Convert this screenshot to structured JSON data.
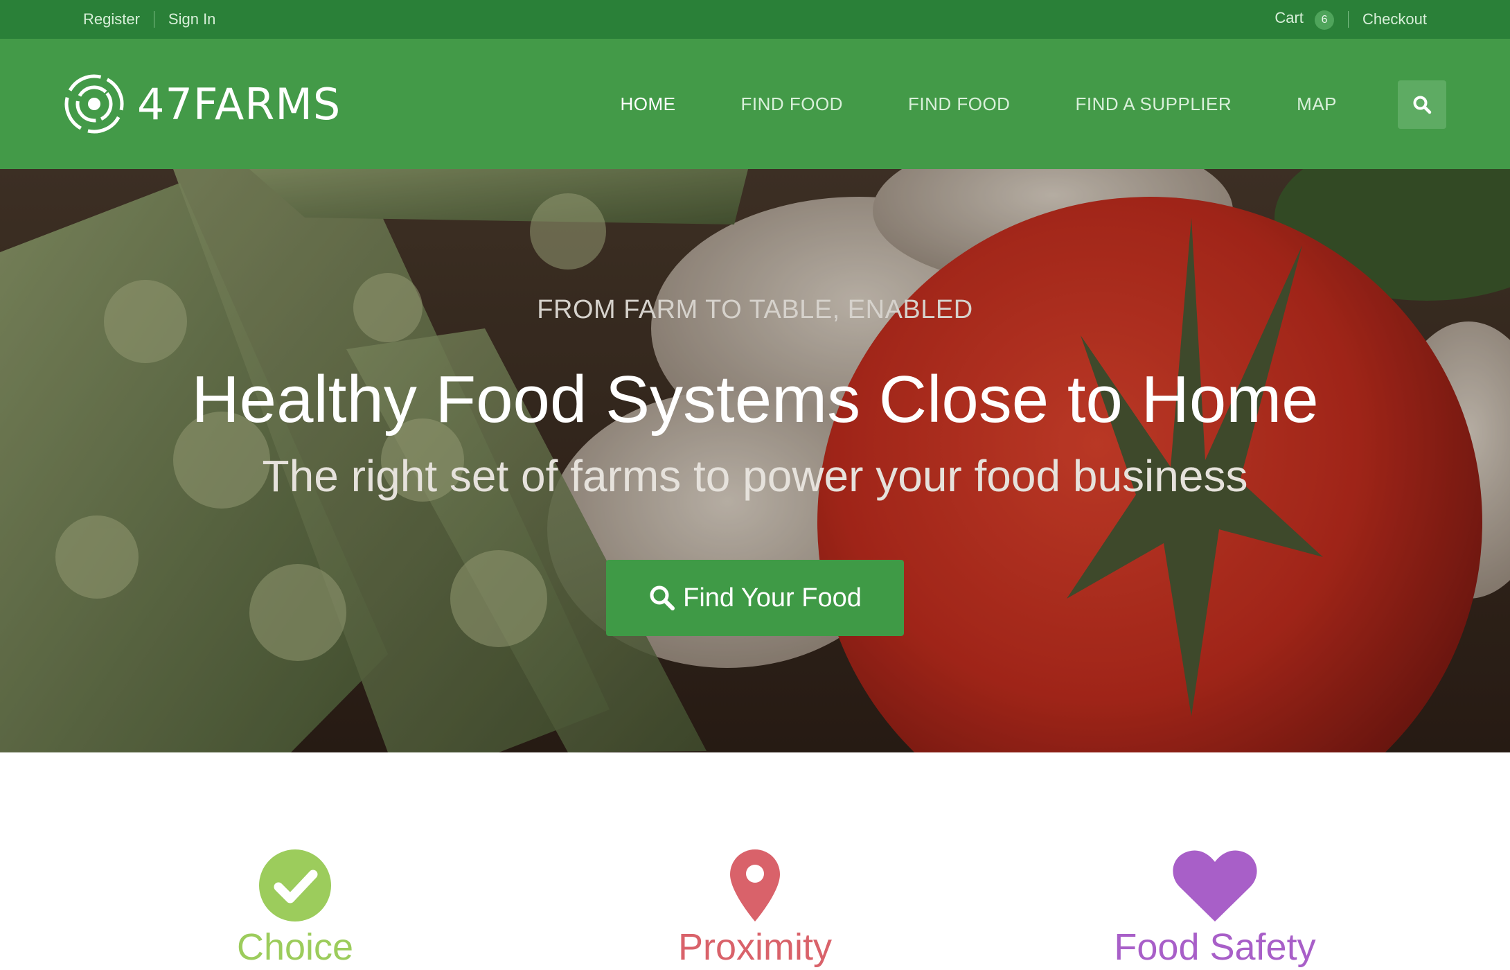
{
  "topbar": {
    "register": "Register",
    "sign_in": "Sign In",
    "cart": "Cart",
    "cart_count": "6",
    "checkout": "Checkout"
  },
  "brand": {
    "name": "47FARMS",
    "icon": "target-logo-icon"
  },
  "nav": {
    "items": [
      {
        "label": "HOME",
        "active": true
      },
      {
        "label": "FIND FOOD",
        "active": false
      },
      {
        "label": "FIND FOOD",
        "active": false
      },
      {
        "label": "FIND A SUPPLIER",
        "active": false
      },
      {
        "label": "MAP",
        "active": false
      }
    ],
    "search_icon": "search-icon"
  },
  "hero": {
    "eyebrow": "FROM FARM TO TABLE, ENABLED",
    "title": "Healthy Food Systems Close to Home",
    "subtitle": "The right set of farms to power your food business",
    "cta_label": "Find Your Food",
    "cta_icon": "search-icon"
  },
  "features": [
    {
      "label": "Choice",
      "icon": "check-circle-icon",
      "color": "#9ccc5c"
    },
    {
      "label": "Proximity",
      "icon": "map-pin-icon",
      "color": "#d9626a"
    },
    {
      "label": "Food Safety",
      "icon": "heart-icon",
      "color": "#a85fc8"
    }
  ],
  "colors": {
    "topbar": "#2a8038",
    "navbar": "#439a48",
    "accent": "#3f9a46"
  }
}
